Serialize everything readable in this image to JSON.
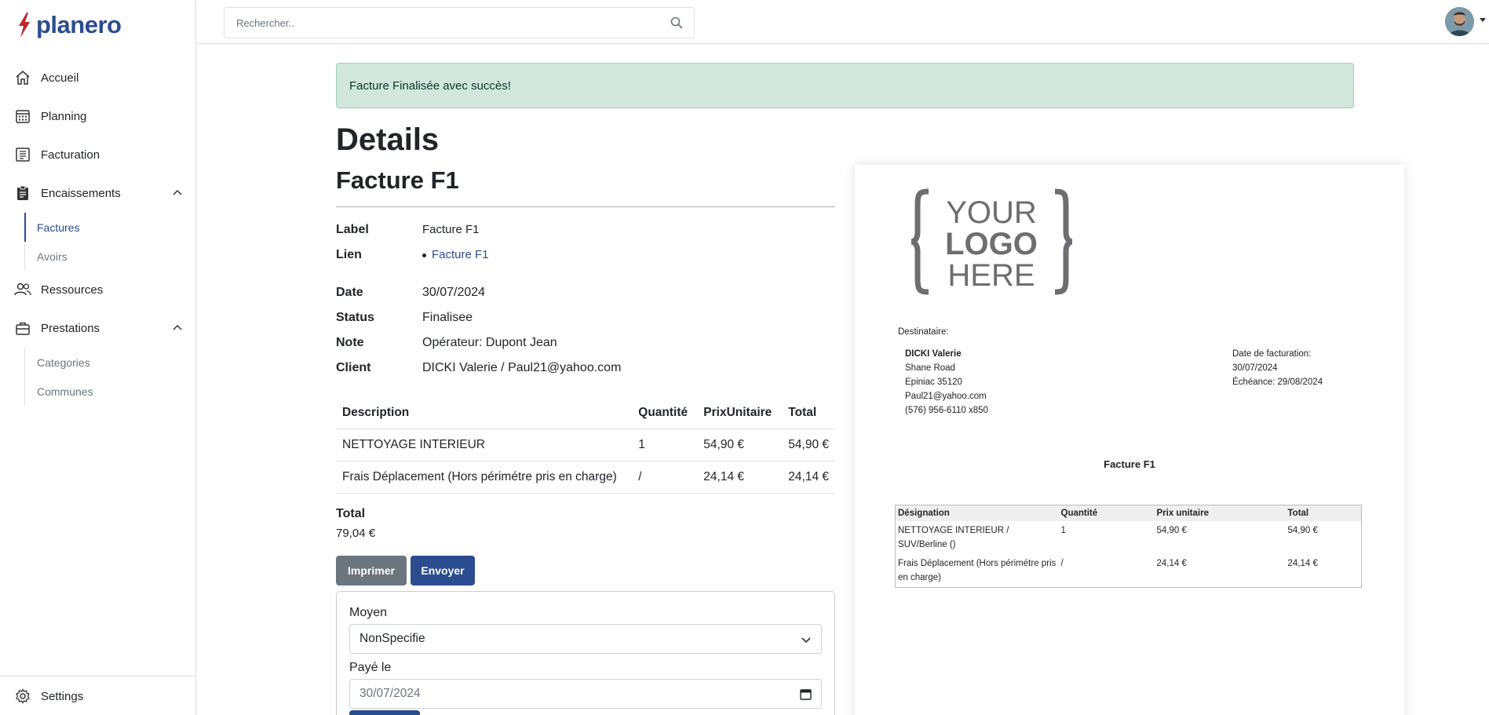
{
  "brand": {
    "name": "planero",
    "color": "#2b4d8f",
    "bolt_color": "#c0272d"
  },
  "sidebar": {
    "items": [
      {
        "label": "Accueil",
        "icon": "home-icon"
      },
      {
        "label": "Planning",
        "icon": "calendar-icon"
      },
      {
        "label": "Facturation",
        "icon": "document-icon"
      },
      {
        "label": "Encaissements",
        "icon": "clipboard-icon",
        "expanded": true,
        "children": [
          {
            "label": "Factures",
            "active": true
          },
          {
            "label": "Avoirs"
          }
        ]
      },
      {
        "label": "Ressources",
        "icon": "users-icon"
      },
      {
        "label": "Prestations",
        "icon": "briefcase-icon",
        "expanded": true,
        "children": [
          {
            "label": "Categories"
          },
          {
            "label": "Communes"
          }
        ]
      }
    ],
    "settings": {
      "label": "Settings",
      "icon": "gear-icon"
    }
  },
  "topbar": {
    "search_placeholder": "Rechercher.."
  },
  "alert": {
    "message": "Facture Finalisée avec succès!"
  },
  "page": {
    "title": "Details",
    "subtitle": "Facture F1"
  },
  "details": {
    "label_key": "Label",
    "label_val": "Facture F1",
    "lien_key": "Lien",
    "lien_val": "Facture F1",
    "date_key": "Date",
    "date_val": "30/07/2024",
    "status_key": "Status",
    "status_val": "Finalisee",
    "note_key": "Note",
    "note_val": "Opérateur: Dupont Jean",
    "client_key": "Client",
    "client_val": "DICKI Valerie / Paul21@yahoo.com"
  },
  "items_table": {
    "headers": [
      "Description",
      "Quantité",
      "PrixUnitaire",
      "Total"
    ],
    "rows": [
      [
        "NETTOYAGE INTERIEUR",
        "1",
        "54,90 €",
        "54,90 €"
      ],
      [
        "Frais Déplacement (Hors périmétre pris en charge)",
        "/",
        "24,14 €",
        "24,14 €"
      ]
    ]
  },
  "total": {
    "label": "Total",
    "value": "79,04 €"
  },
  "actions": {
    "print": "Imprimer",
    "send": "Envoyer"
  },
  "payment": {
    "method_label": "Moyen",
    "method_value": "NonSpecifie",
    "paid_label": "Payé le",
    "paid_value": "30/07/2024"
  },
  "preview": {
    "logo": {
      "line1": "YOUR",
      "line2": "LOGO",
      "line3": "HERE"
    },
    "recipient_label": "Destinataire:",
    "recipient": {
      "name": "DICKI Valerie",
      "street": "Shane Road",
      "city": "Epiniac 35120",
      "email": "Paul21@yahoo.com",
      "phone": "(576) 956-6110 x850"
    },
    "billing_date_label": "Date de facturation:",
    "billing_date": "30/07/2024",
    "due": "Échéance: 29/08/2024",
    "invoice_title": "Facture F1",
    "table": {
      "headers": [
        "Désignation",
        "Quantité",
        "Prix unitaire",
        "Total"
      ],
      "rows": [
        [
          "NETTOYAGE INTERIEUR / SUV/Berline ()",
          "1",
          "54,90 €",
          "54,90 €"
        ],
        [
          "Frais Déplacement (Hors périmétre pris en charge)",
          "/",
          "24,14 €",
          "24,14 €"
        ]
      ]
    }
  }
}
